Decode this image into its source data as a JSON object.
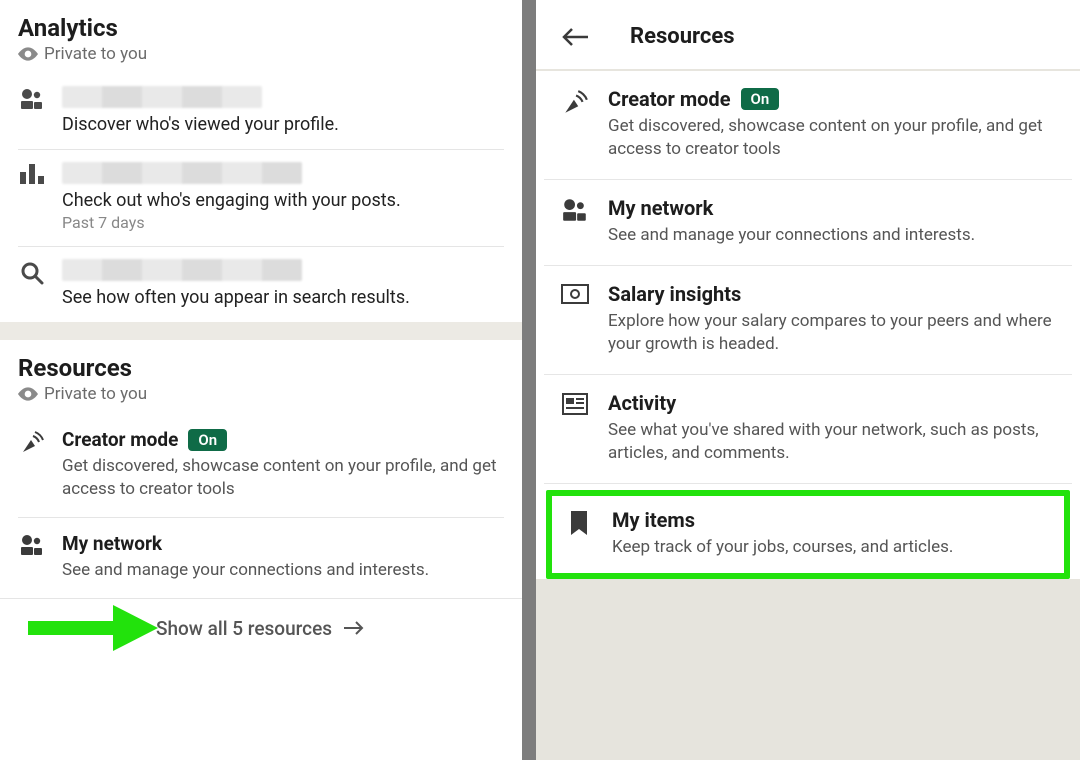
{
  "analytics": {
    "title": "Analytics",
    "privacy": "Private to you",
    "items": [
      {
        "desc": "Discover who's viewed your profile."
      },
      {
        "desc": "Check out who's engaging with your posts.",
        "sub": "Past 7 days"
      },
      {
        "desc": "See how often you appear in search results."
      }
    ]
  },
  "resourcesLeft": {
    "title": "Resources",
    "privacy": "Private to you",
    "creator": {
      "title": "Creator mode",
      "badge": "On",
      "desc": "Get discovered, showcase content on your profile, and get access to creator tools"
    },
    "network": {
      "title": "My network",
      "desc": "See and manage your connections and interests."
    },
    "showAll": "Show all 5 resources"
  },
  "right": {
    "title": "Resources",
    "items": {
      "creator": {
        "title": "Creator mode",
        "badge": "On",
        "desc": "Get discovered, showcase content on your profile, and get access to creator tools"
      },
      "network": {
        "title": "My network",
        "desc": "See and manage your connections and interests."
      },
      "salary": {
        "title": "Salary insights",
        "desc": "Explore how your salary compares to your peers and where your growth is headed."
      },
      "activity": {
        "title": "Activity",
        "desc": "See what you've shared with your network, such as posts, articles, and comments."
      },
      "myitems": {
        "title": "My items",
        "desc": "Keep track of your jobs, courses, and articles."
      }
    }
  }
}
